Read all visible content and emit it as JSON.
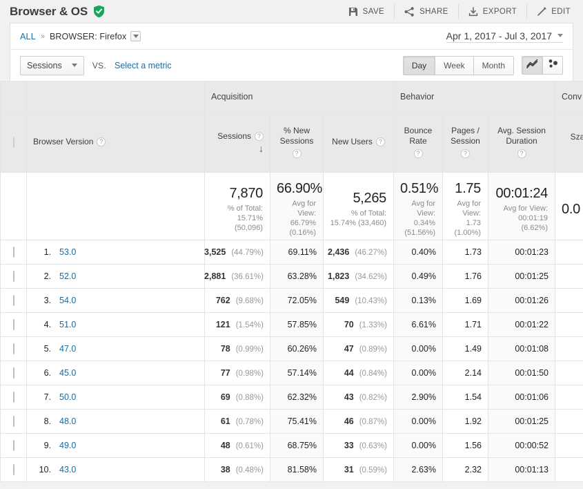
{
  "header": {
    "title": "Browser & OS",
    "verified_icon": "green-shield-check-icon",
    "actions": [
      {
        "label": "SAVE",
        "icon": "save-floppy-icon"
      },
      {
        "label": "SHARE",
        "icon": "share-nodes-icon"
      },
      {
        "label": "EXPORT",
        "icon": "export-download-icon"
      },
      {
        "label": "EDIT",
        "icon": "edit-pencil-icon"
      }
    ]
  },
  "breadcrumb": {
    "all_label": "ALL",
    "separator": "»",
    "current": "BROWSER: Firefox",
    "dropdown_icon": "chevron-down-icon"
  },
  "date_range": {
    "label": "Apr 1, 2017 - Jul 3, 2017",
    "dropdown_icon": "chevron-down-icon"
  },
  "metric_selector": {
    "selected": "Sessions",
    "dropdown_icon": "chevron-down-icon",
    "vs_label": "VS.",
    "select_metric_link": "Select a metric"
  },
  "granularity": {
    "options": [
      "Day",
      "Week",
      "Month"
    ],
    "selected": "Day"
  },
  "chart_toggle": {
    "options": [
      {
        "icon": "line-chart-icon",
        "selected": true
      },
      {
        "icon": "scatter-plot-icon",
        "selected": false
      }
    ]
  },
  "table": {
    "groups": [
      {
        "label": "",
        "span": 2
      },
      {
        "label": "Acquisition",
        "span": 3
      },
      {
        "label": "Behavior",
        "span": 3
      },
      {
        "label": "Conv",
        "span": 1
      }
    ],
    "dimension_header": "Browser Version",
    "columns": [
      {
        "label": "Sessions",
        "help": true,
        "sorted": "desc"
      },
      {
        "label": "% New Sessions",
        "help": true
      },
      {
        "label": "New Users",
        "help": true
      },
      {
        "label": "Bounce Rate",
        "help": true
      },
      {
        "label": "Pages / Session",
        "help": true
      },
      {
        "label": "Avg. Session Duration",
        "help": true
      },
      {
        "label": "Sza adı (G- Conv Rate",
        "help": false
      }
    ],
    "summary": {
      "sessions": {
        "value": "7,870",
        "sub": "% of Total: 15.71% (50,096)"
      },
      "pct_new": {
        "value": "66.90%",
        "sub": "Avg for View: 66.79% (0.16%)"
      },
      "new_users": {
        "value": "5,265",
        "sub": "% of Total: 15.74% (33,460)"
      },
      "bounce_rate": {
        "value": "0.51%",
        "sub": "Avg for View: 0.34% (51.56%)"
      },
      "pages_session": {
        "value": "1.75",
        "sub": "Avg for View: 1.73 (1.00%)"
      },
      "avg_duration": {
        "value": "00:01:24",
        "sub": "Avg for View: 00:01:19 (6.62%)"
      },
      "conversion": {
        "value": "0.0",
        "sub": ""
      }
    },
    "rows": [
      {
        "index": "1.",
        "version": "53.0",
        "sessions": "3,525",
        "sessions_pct": "(44.79%)",
        "pct_new": "69.11%",
        "new_users": "2,436",
        "new_users_pct": "(46.27%)",
        "bounce_rate": "0.40%",
        "pages_session": "1.73",
        "avg_duration": "00:01:23"
      },
      {
        "index": "2.",
        "version": "52.0",
        "sessions": "2,881",
        "sessions_pct": "(36.61%)",
        "pct_new": "63.28%",
        "new_users": "1,823",
        "new_users_pct": "(34.62%)",
        "bounce_rate": "0.49%",
        "pages_session": "1.76",
        "avg_duration": "00:01:25"
      },
      {
        "index": "3.",
        "version": "54.0",
        "sessions": "762",
        "sessions_pct": "(9.68%)",
        "pct_new": "72.05%",
        "new_users": "549",
        "new_users_pct": "(10.43%)",
        "bounce_rate": "0.13%",
        "pages_session": "1.69",
        "avg_duration": "00:01:26"
      },
      {
        "index": "4.",
        "version": "51.0",
        "sessions": "121",
        "sessions_pct": "(1.54%)",
        "pct_new": "57.85%",
        "new_users": "70",
        "new_users_pct": "(1.33%)",
        "bounce_rate": "6.61%",
        "pages_session": "1.71",
        "avg_duration": "00:01:22"
      },
      {
        "index": "5.",
        "version": "47.0",
        "sessions": "78",
        "sessions_pct": "(0.99%)",
        "pct_new": "60.26%",
        "new_users": "47",
        "new_users_pct": "(0.89%)",
        "bounce_rate": "0.00%",
        "pages_session": "1.49",
        "avg_duration": "00:01:08"
      },
      {
        "index": "6.",
        "version": "45.0",
        "sessions": "77",
        "sessions_pct": "(0.98%)",
        "pct_new": "57.14%",
        "new_users": "44",
        "new_users_pct": "(0.84%)",
        "bounce_rate": "0.00%",
        "pages_session": "2.14",
        "avg_duration": "00:01:50"
      },
      {
        "index": "7.",
        "version": "50.0",
        "sessions": "69",
        "sessions_pct": "(0.88%)",
        "pct_new": "62.32%",
        "new_users": "43",
        "new_users_pct": "(0.82%)",
        "bounce_rate": "2.90%",
        "pages_session": "1.54",
        "avg_duration": "00:01:06"
      },
      {
        "index": "8.",
        "version": "48.0",
        "sessions": "61",
        "sessions_pct": "(0.78%)",
        "pct_new": "75.41%",
        "new_users": "46",
        "new_users_pct": "(0.87%)",
        "bounce_rate": "0.00%",
        "pages_session": "1.92",
        "avg_duration": "00:01:25"
      },
      {
        "index": "9.",
        "version": "49.0",
        "sessions": "48",
        "sessions_pct": "(0.61%)",
        "pct_new": "68.75%",
        "new_users": "33",
        "new_users_pct": "(0.63%)",
        "bounce_rate": "0.00%",
        "pages_session": "1.56",
        "avg_duration": "00:00:52"
      },
      {
        "index": "10.",
        "version": "43.0",
        "sessions": "38",
        "sessions_pct": "(0.48%)",
        "pct_new": "81.58%",
        "new_users": "31",
        "new_users_pct": "(0.59%)",
        "bounce_rate": "2.63%",
        "pages_session": "2.32",
        "avg_duration": "00:01:13"
      }
    ]
  },
  "colors": {
    "link": "#186ba0",
    "verified_green": "#1aa260",
    "page_bg": "#f1f1f1",
    "header_bg": "#e9e9e9"
  }
}
